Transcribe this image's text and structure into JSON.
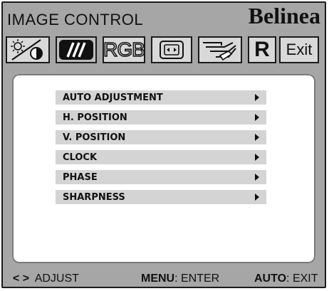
{
  "header": {
    "title": "IMAGE CONTROL",
    "brand": "Belinea"
  },
  "toolbar": {
    "tabs": [
      {
        "icon": "brightness-contrast-icon"
      },
      {
        "icon": "image-control-icon",
        "selected": true
      },
      {
        "label": "RGB"
      },
      {
        "icon": "geometry-icon"
      },
      {
        "icon": "setup-hand-icon"
      },
      {
        "label": "R",
        "icon": "reset-icon"
      },
      {
        "label": "Exit"
      }
    ]
  },
  "menu": {
    "items": [
      {
        "label": "AUTO ADJUSTMENT"
      },
      {
        "label": "H. POSITION"
      },
      {
        "label": "V. POSITION"
      },
      {
        "label": "CLOCK"
      },
      {
        "label": "PHASE"
      },
      {
        "label": "SHARPNESS"
      }
    ]
  },
  "footer": {
    "adjust_keys": "< >",
    "adjust_label": "ADJUST",
    "menu_key": "MENU",
    "menu_label": ": ENTER",
    "auto_key": "AUTO",
    "auto_label": ": EXIT"
  }
}
